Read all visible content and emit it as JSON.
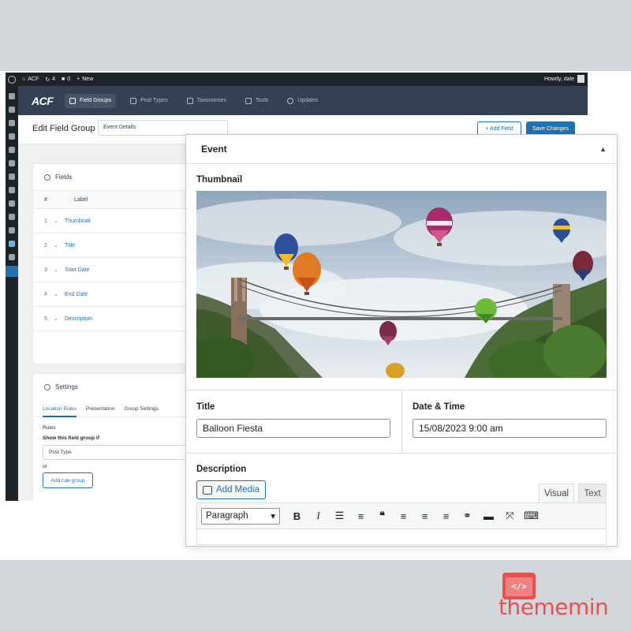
{
  "admin_bar": {
    "site_name": "ACF",
    "updates_count": "4",
    "comments_count": "0",
    "new_label": "New",
    "howdy": "Howdy, dale"
  },
  "acf_nav": {
    "logo": "ACF",
    "tabs": [
      {
        "label": "Field Groups",
        "icon": "grid-icon"
      },
      {
        "label": "Post Types",
        "icon": "post-icon"
      },
      {
        "label": "Taxonomies",
        "icon": "tag-icon"
      },
      {
        "label": "Tools",
        "icon": "wrench-icon"
      },
      {
        "label": "Updates",
        "icon": "download-icon"
      }
    ]
  },
  "header": {
    "page_title": "Edit Field Group",
    "group_title_value": "Event Details",
    "add_field_label": "+ Add Field",
    "save_label": "Save Changes"
  },
  "fields_panel": {
    "title": "Fields",
    "col_num": "#",
    "col_label": "Label",
    "rows": [
      {
        "num": "1",
        "label": "Thumbnail"
      },
      {
        "num": "2",
        "label": "Title"
      },
      {
        "num": "3",
        "label": "Start Date"
      },
      {
        "num": "4",
        "label": "End Date"
      },
      {
        "num": "5",
        "label": "Description"
      }
    ]
  },
  "settings_panel": {
    "title": "Settings",
    "tabs": [
      "Location Rules",
      "Presentation",
      "Group Settings"
    ],
    "rules_label": "Rules",
    "show_if_label": "Show this field group if",
    "rule_value": "Post Type",
    "or_label": "or",
    "add_rule_label": "Add rule group"
  },
  "editor": {
    "box_title": "Event",
    "thumbnail_label": "Thumbnail",
    "title_label": "Title",
    "title_value": "Balloon Fiesta",
    "date_label": "Date & Time",
    "date_value": "15/08/2023 9:00 am",
    "description_label": "Description",
    "add_media_label": "Add Media",
    "visual_tab": "Visual",
    "text_tab": "Text",
    "format_select": "Paragraph"
  },
  "brand": {
    "text": "thememin",
    "glyph": "</>"
  },
  "colors": {
    "acf_header": "#344054",
    "wp_blue": "#2271b1",
    "admin_bar": "#1d2327",
    "brand_red": "#e6514f"
  }
}
